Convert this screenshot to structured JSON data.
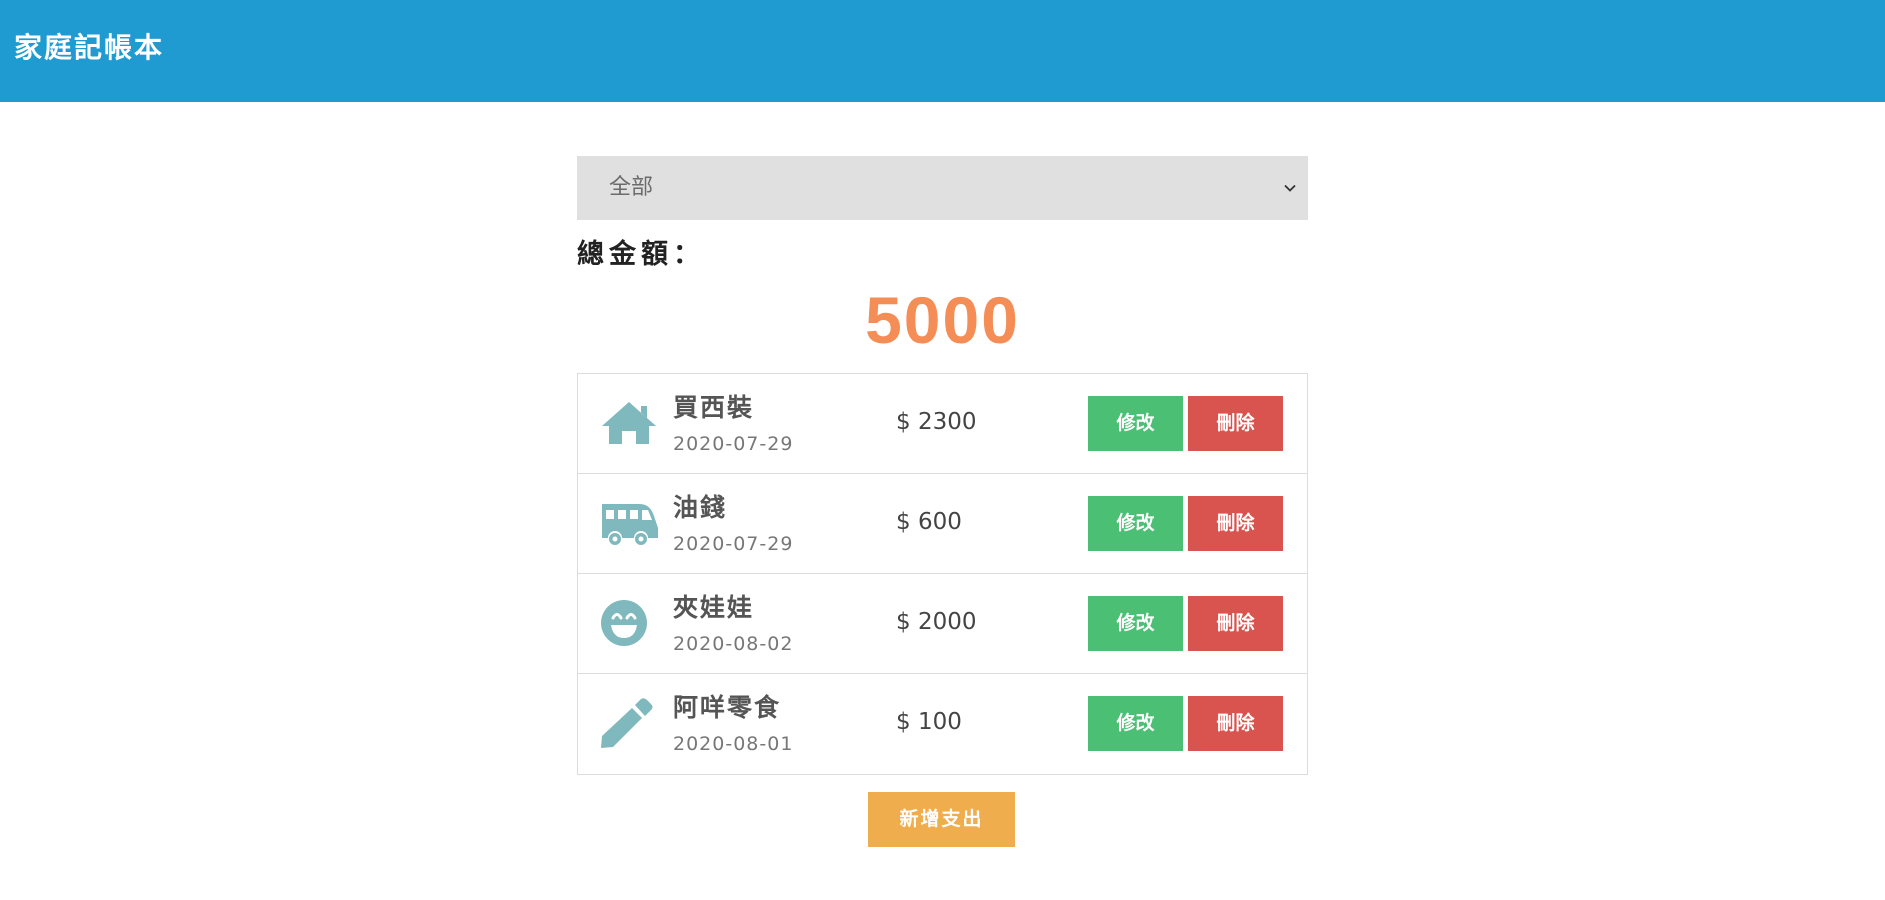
{
  "app": {
    "title": "家庭記帳本"
  },
  "filter": {
    "selected": "全部"
  },
  "summary": {
    "total_label": "總金額：",
    "total_value": "5000"
  },
  "expenses": [
    {
      "icon": "home-icon",
      "name": "買西裝",
      "date": "2020-07-29",
      "amount": "$ 2300"
    },
    {
      "icon": "bus-icon",
      "name": "油錢",
      "date": "2020-07-29",
      "amount": "$ 600"
    },
    {
      "icon": "smile-icon",
      "name": "夾娃娃",
      "date": "2020-08-02",
      "amount": "$ 2000"
    },
    {
      "icon": "pencil-icon",
      "name": "阿咩零食",
      "date": "2020-08-01",
      "amount": "$ 100"
    }
  ],
  "actions": {
    "edit_label": "修改",
    "delete_label": "刪除",
    "add_label": "新增支出"
  },
  "colors": {
    "navbar": "#1f9bd1",
    "total": "#f48d56",
    "icon": "#7fb8bd",
    "edit": "#4bbf73",
    "delete": "#d9534f",
    "add": "#f0ad4e"
  }
}
